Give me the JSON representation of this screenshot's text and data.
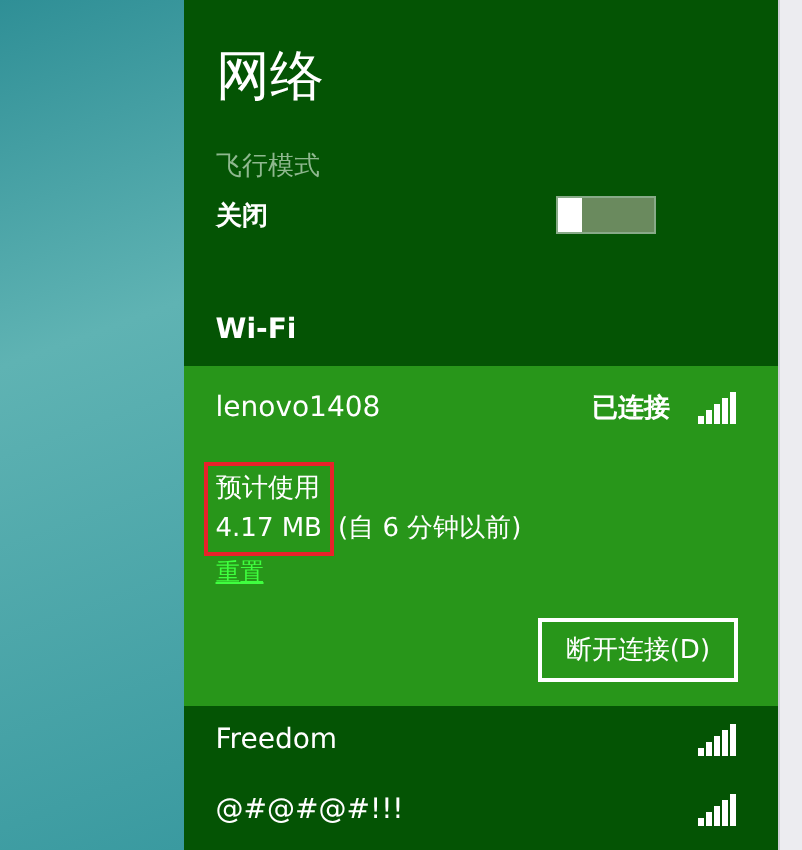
{
  "title": "网络",
  "airplane_mode": {
    "label": "飞行模式",
    "state_text": "关闭",
    "on": false
  },
  "wifi": {
    "heading": "Wi-Fi",
    "networks": [
      {
        "name": "lenovo1408",
        "status": "已连接",
        "selected": true,
        "usage_label": "预计使用",
        "usage_value": "4.17 MB",
        "usage_time": "(自 6 分钟以前)",
        "reset_link": "重置",
        "button": "断开连接(D)"
      },
      {
        "name": "Freedom",
        "selected": false
      },
      {
        "name": "@#@#@#!!!",
        "selected": false
      }
    ]
  }
}
